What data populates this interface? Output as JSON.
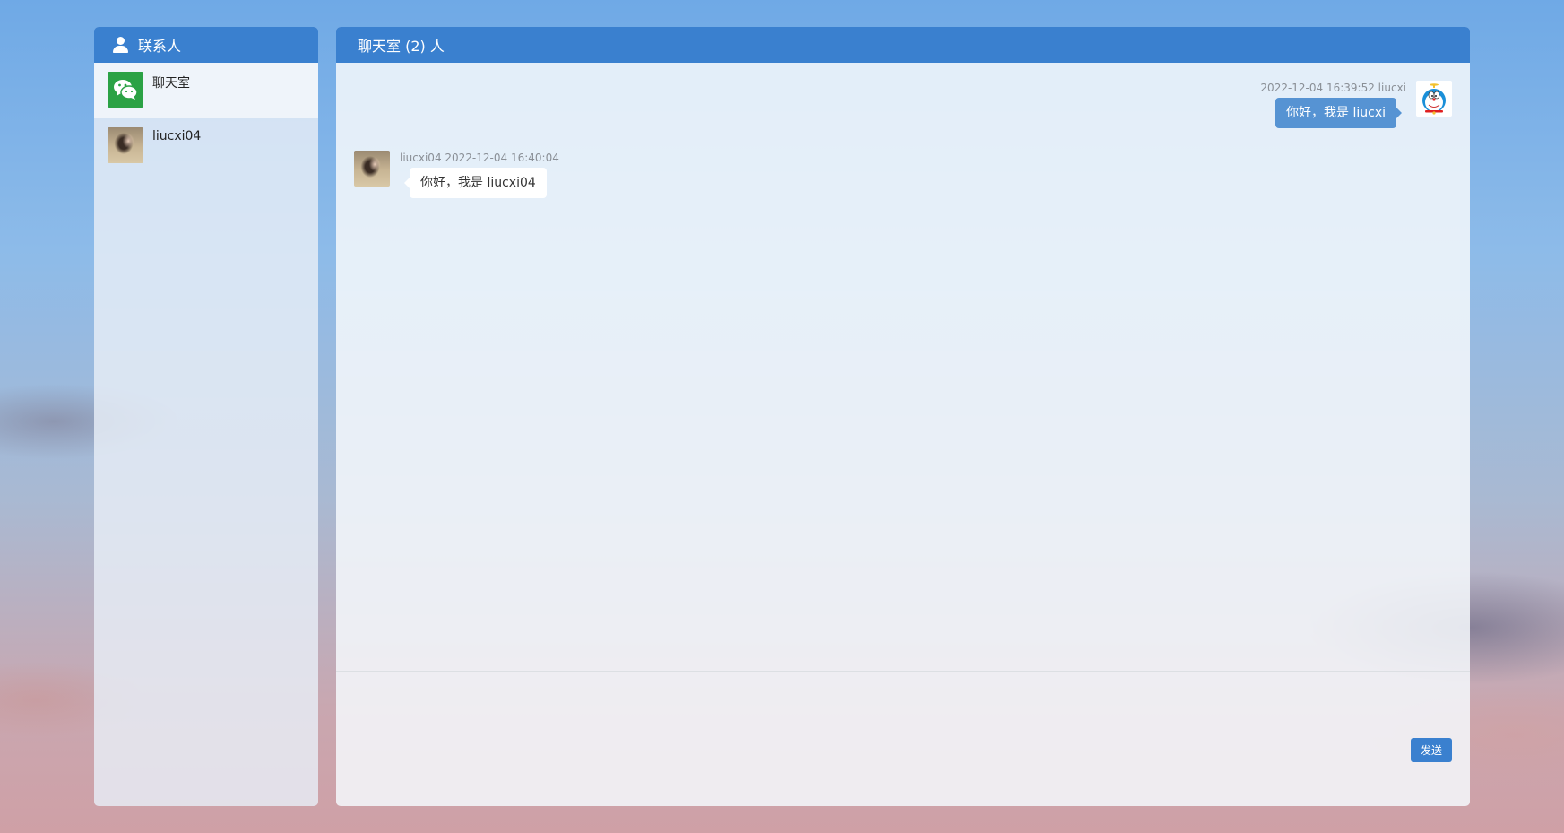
{
  "contacts_panel": {
    "title": "联系人",
    "items": [
      {
        "name": "聊天室",
        "icon": "wechat-icon",
        "active": true
      },
      {
        "name": "liucxi04",
        "icon": "photo-avatar",
        "active": false
      }
    ]
  },
  "chat_panel": {
    "title": "聊天室 (2) 人",
    "messages": [
      {
        "side": "right",
        "meta": "2022-12-04 16:39:52 liucxi",
        "text": "你好，我是 liucxi",
        "avatar": "doraemon-avatar"
      },
      {
        "side": "left",
        "meta": "liucxi04 2022-12-04 16:40:04",
        "text": "你好，我是 liucxi04",
        "avatar": "photo-avatar"
      }
    ],
    "input_value": "",
    "send_label": "发送"
  },
  "colors": {
    "header_blue": "#3a80cf",
    "wechat_green": "#2ba245",
    "my_bubble": "#5693d3"
  }
}
